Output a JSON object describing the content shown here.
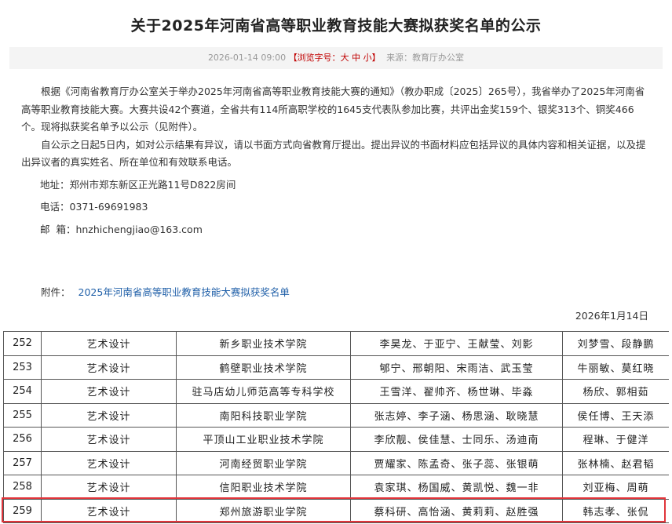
{
  "title": "关于2025年河南省高等职业教育技能大赛拟获奖名单的公示",
  "meta": {
    "datetime": "2026-01-14 09:00",
    "font_size_prefix": "【浏览字号：",
    "font_size_large": "大",
    "font_size_medium": "中",
    "font_size_small": "小",
    "font_size_suffix": "】",
    "source_label": "来源：",
    "source": "教育厅办公室"
  },
  "body": {
    "para1": "根据《河南省教育厅办公室关于举办2025年河南省高等职业教育技能大赛的通知》（教办职成〔2025〕265号），我省举办了2025年河南省高等职业教育技能大赛。大赛共设42个赛道，全省共有114所高职学校的1645支代表队参加比赛，共评出金奖159个、银奖313个、铜奖466个。现将拟获奖名单予以公示（见附件）。",
    "para2": "自公示之日起5日内，如对公示结果有异议，请以书面方式向省教育厅提出。提出异议的书面材料应包括异议的具体内容和相关证据，以及提出异议者的真实姓名、所在单位和有效联系电话。",
    "address": "地址：郑州市郑东新区正光路11号D822房间",
    "phone": "电话：0371-69691983",
    "email": "邮  箱：hnzhichengjiao@163.com"
  },
  "attachment": {
    "label": "附件：",
    "link": "2025年河南省高等职业教育技能大赛拟获奖名单"
  },
  "date": "2026年1月14日",
  "table": {
    "rows": [
      {
        "no": "252",
        "track": "艺术设计",
        "school": "新乡职业技术学院",
        "members": "李昊龙、于亚宁、王献莹、刘影",
        "advisors": "刘梦雪、段静鹏"
      },
      {
        "no": "253",
        "track": "艺术设计",
        "school": "鹤壁职业技术学院",
        "members": "郇宁、邢朝阳、宋雨洁、武玉莹",
        "advisors": "牛丽敏、莫红晓"
      },
      {
        "no": "254",
        "track": "艺术设计",
        "school": "驻马店幼儿师范高等专科学校",
        "members": "王雪洋、翟帅齐、杨世琳、毕淼",
        "advisors": "杨欣、郭相茹"
      },
      {
        "no": "255",
        "track": "艺术设计",
        "school": "南阳科技职业学院",
        "members": "张志婷、李子涵、杨思涵、耿晓慧",
        "advisors": "侯任博、王天添"
      },
      {
        "no": "256",
        "track": "艺术设计",
        "school": "平顶山工业职业技术学院",
        "members": "李欣靓、侯佳慧、士同乐、汤迪南",
        "advisors": "程琳、于健洋"
      },
      {
        "no": "257",
        "track": "艺术设计",
        "school": "河南经贸职业学院",
        "members": "贾耀家、陈孟奇、张子蕊、张银萌",
        "advisors": "张林楠、赵君韬"
      },
      {
        "no": "258",
        "track": "艺术设计",
        "school": "信阳职业技术学院",
        "members": "袁家琪、杨国威、黄凯悦、魏一非",
        "advisors": "刘亚梅、周萌"
      },
      {
        "no": "259",
        "track": "艺术设计",
        "school": "郑州旅游职业学院",
        "members": "蔡科研、高怡涵、黄莉莉、赵胜强",
        "advisors": "韩志孝、张侃"
      }
    ]
  },
  "colors": {
    "highlight_border": "#e0353b",
    "link": "#1f5fa8",
    "font_size_control": "#c00000"
  }
}
